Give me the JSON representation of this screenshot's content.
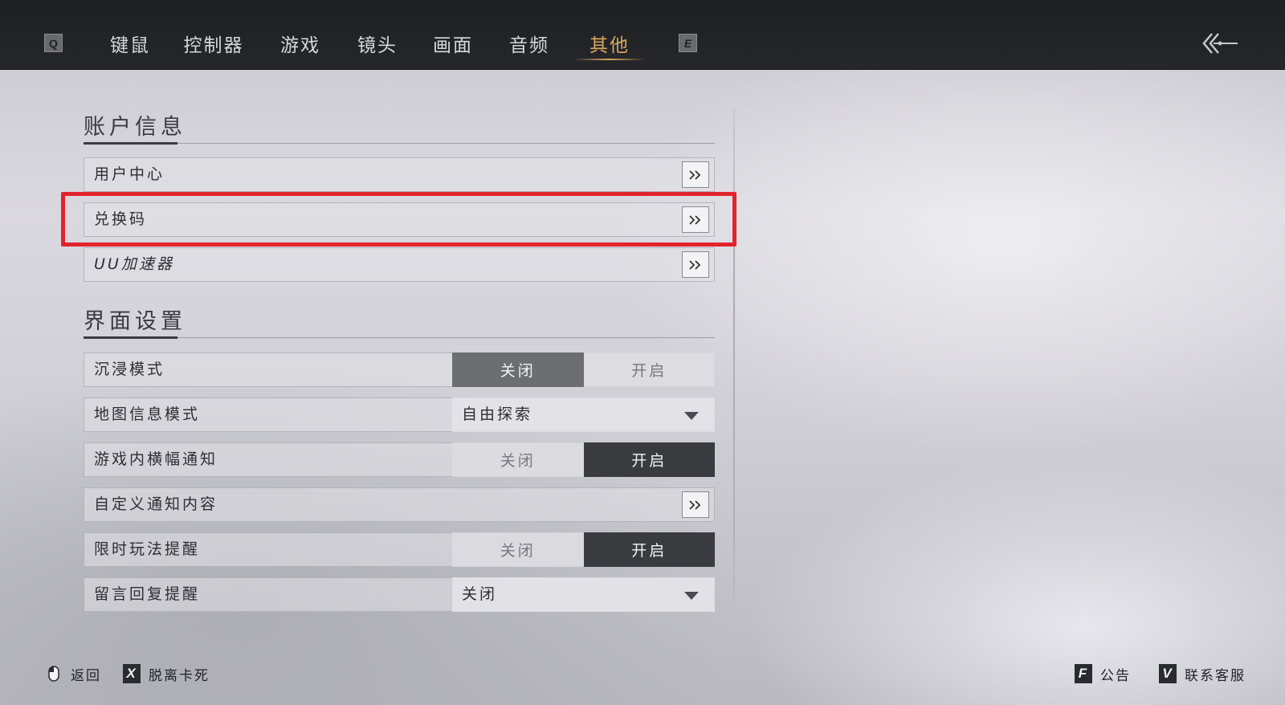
{
  "nav": {
    "left_key": "Q",
    "right_key": "E",
    "tabs": [
      {
        "label": "键鼠"
      },
      {
        "label": "控制器"
      },
      {
        "label": "游戏"
      },
      {
        "label": "镜头"
      },
      {
        "label": "画面"
      },
      {
        "label": "音频"
      },
      {
        "label": "其他",
        "active": true
      }
    ],
    "accent_color": "#d9a85a"
  },
  "account": {
    "title": "账户信息",
    "items": [
      {
        "label": "用户中心"
      },
      {
        "label": "兑换码",
        "highlighted": true
      },
      {
        "label": "UU加速器"
      }
    ]
  },
  "interface": {
    "title": "界面设置",
    "immersive": {
      "label": "沉浸模式",
      "off": "关闭",
      "on": "开启",
      "selected": "off"
    },
    "map_mode": {
      "label": "地图信息模式",
      "value": "自由探索"
    },
    "banner": {
      "label": "游戏内横幅通知",
      "off": "关闭",
      "on": "开启",
      "selected": "on"
    },
    "custom_notify": {
      "label": "自定义通知内容"
    },
    "limited": {
      "label": "限时玩法提醒",
      "off": "关闭",
      "on": "开启",
      "selected": "on"
    },
    "reply": {
      "label": "留言回复提醒",
      "value": "关闭"
    }
  },
  "highlight_color": "#e3232c",
  "footer": {
    "back": {
      "label": "返回",
      "icon": "mouse-icon"
    },
    "unstuck": {
      "key": "X",
      "label": "脱离卡死"
    },
    "notice": {
      "key": "F",
      "label": "公告"
    },
    "support": {
      "key": "V",
      "label": "联系客服"
    }
  }
}
